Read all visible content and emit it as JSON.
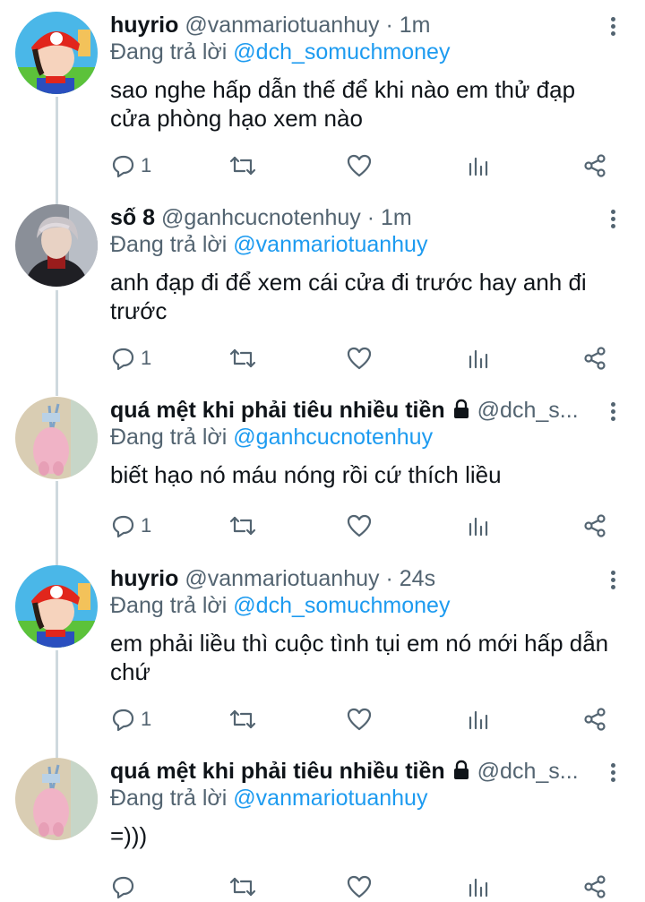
{
  "tweets": [
    {
      "name": "huyrio",
      "handle": "@vanmariotuanhuy",
      "time": "1m",
      "replying_label": "Đang trả lời",
      "replying_to": "@dch_somuchmoney",
      "text": "sao nghe hấp dẫn thế để khi nào em thử đạp cửa phòng hạo xem nào",
      "reply_count": "1",
      "avatar": "mario-hat-avatar"
    },
    {
      "name": "số 8",
      "handle": "@ganhcucnotenhuy",
      "time": "1m",
      "replying_label": "Đang trả lời",
      "replying_to": "@vanmariotuanhuy",
      "text": "anh đạp đi để xem cái cửa đi trước hay anh đi trước",
      "reply_count": "1",
      "avatar": "portrait-avatar"
    },
    {
      "name": "quá mệt khi phải tiêu nhiều tiền",
      "handle": "@dch_s...",
      "time": "",
      "replying_label": "Đang trả lời",
      "replying_to": "@ganhcucnotenhuy",
      "text": "biết hạo nó máu nóng rồi cứ thích liều",
      "reply_count": "1",
      "avatar": "pink-bunny-avatar",
      "protected": true
    },
    {
      "name": "huyrio",
      "handle": "@vanmariotuanhuy",
      "time": "24s",
      "replying_label": "Đang trả lời",
      "replying_to": "@dch_somuchmoney",
      "text": "em phải liều thì cuộc tình tụi em nó mới hấp dẫn chứ",
      "reply_count": "1",
      "avatar": "mario-hat-avatar"
    },
    {
      "name": "quá mệt khi phải tiêu nhiều tiền",
      "handle": "@dch_s...",
      "time": "",
      "replying_label": "Đang trả lời",
      "replying_to": "@vanmariotuanhuy",
      "text": "=)))",
      "reply_count": "",
      "avatar": "pink-bunny-avatar",
      "protected": true
    }
  ],
  "separator": "·",
  "icons": [
    "reply-icon",
    "retweet-icon",
    "like-icon",
    "views-icon",
    "share-icon",
    "more-icon",
    "lock-icon"
  ],
  "colors": {
    "link": "#1d9bf0",
    "secondary": "#536471",
    "text": "#0f1419",
    "thread_line": "#cfd9de"
  }
}
